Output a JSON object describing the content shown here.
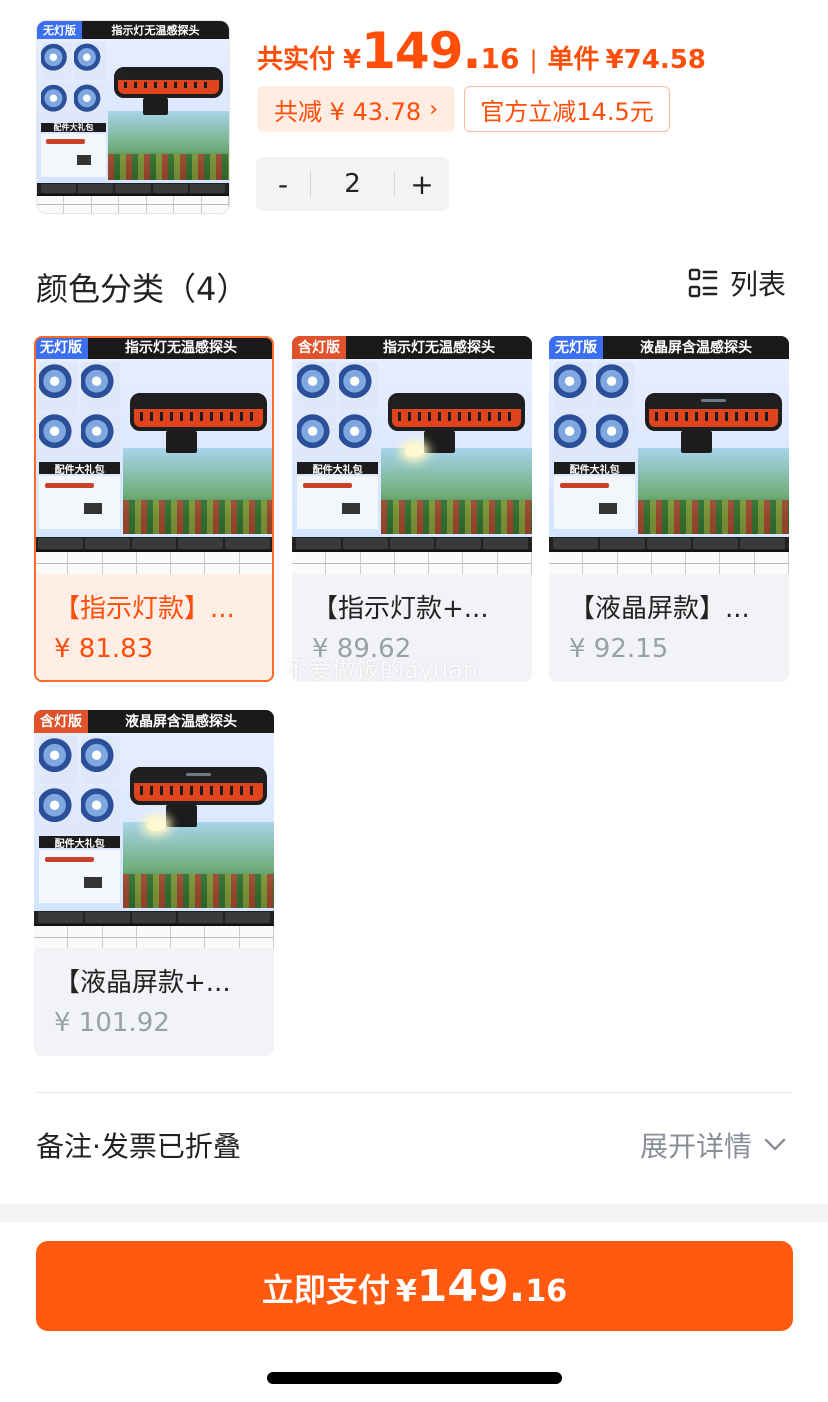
{
  "colors": {
    "accent": "#ff5a0f",
    "price": "#ff4d0a",
    "muted": "#9aa0a8",
    "tag_blue": "#3c6ff0",
    "tag_orange": "#e0522c"
  },
  "header": {
    "total_label": "共实付",
    "currency": "¥",
    "total_int": "149.",
    "total_dec": "16",
    "separator": "|",
    "unit_label": "单件",
    "unit_price": "¥74.58",
    "discount_label": "共减 ¥ 43.78",
    "discount_chevron": "›",
    "coupon_label": "官方立减14.5元",
    "quantity": "2",
    "minus": "-",
    "plus": "+",
    "main_image": {
      "tag": "无灯版",
      "headline": "指示灯无温感探头",
      "gift": "配件大礼包"
    }
  },
  "variants_section": {
    "title": "颜色分类（4）",
    "view_label": "列表",
    "view_icon": "list-view-icon"
  },
  "variants": [
    {
      "name": "【指示灯款】...",
      "price": "¥ 81.83",
      "tag": "无灯版",
      "headline": "指示灯无温感探头",
      "gift": "配件大礼包",
      "selected": true
    },
    {
      "name": "【指示灯款+...",
      "price": "¥ 89.62",
      "tag": "含灯版",
      "headline": "指示灯无温感探头",
      "gift": "配件大礼包",
      "selected": false
    },
    {
      "name": "【液晶屏款】...",
      "price": "¥ 92.15",
      "tag": "无灯版",
      "headline": "液晶屏含温感探头",
      "gift": "配件大礼包",
      "selected": false
    },
    {
      "name": "【液晶屏款+...",
      "price": "¥ 101.92",
      "tag": "含灯版",
      "headline": "液晶屏含温感探头",
      "gift": "配件大礼包",
      "selected": false
    }
  ],
  "watermark": "不爱做饭的ayuan",
  "notes": {
    "label": "备注·发票已折叠",
    "expand_label": "展开详情",
    "expand_icon": "chevron-down-icon"
  },
  "pay_button": {
    "label": "立即支付",
    "currency": "¥",
    "amount_int": "149.",
    "amount_dec": "16"
  }
}
